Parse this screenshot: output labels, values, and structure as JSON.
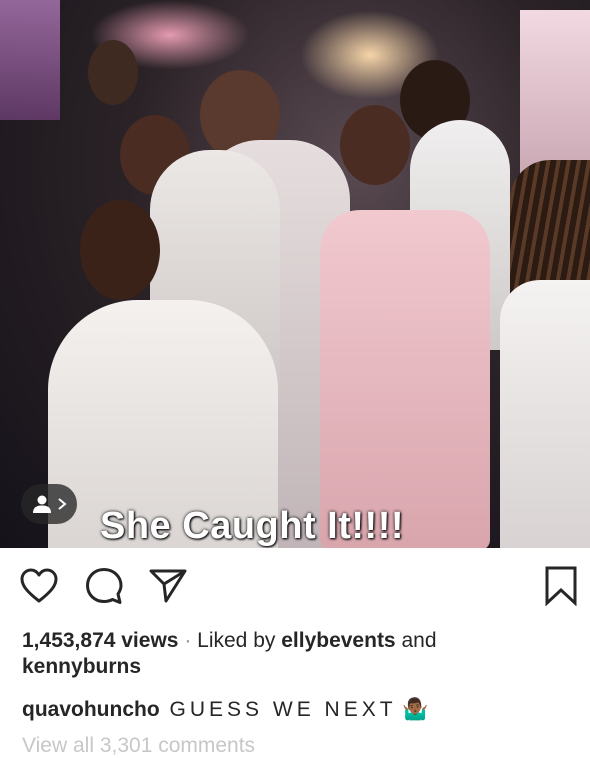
{
  "media": {
    "overlay_text": "She Caught It!!!!",
    "tag_icon": "person-tag-icon"
  },
  "actions": {
    "like_icon": "heart-icon",
    "comment_icon": "comment-icon",
    "share_icon": "send-icon",
    "save_icon": "bookmark-icon"
  },
  "stats": {
    "views": "1,453,874 views",
    "separator": "·",
    "liked_by_prefix": "Liked by",
    "liked_by_user1": "ellybevents",
    "conjunction": "and",
    "liked_by_user2": "kennyburns"
  },
  "caption": {
    "username": "quavohuncho",
    "text": "GUESS WE NEXT",
    "emoji": "🤷🏾‍♂️"
  },
  "comments": {
    "view_all": "View all 3,301 comments"
  },
  "colors": {
    "text": "#262626",
    "muted": "#8e8e8e",
    "faint": "#c7c7c7"
  }
}
